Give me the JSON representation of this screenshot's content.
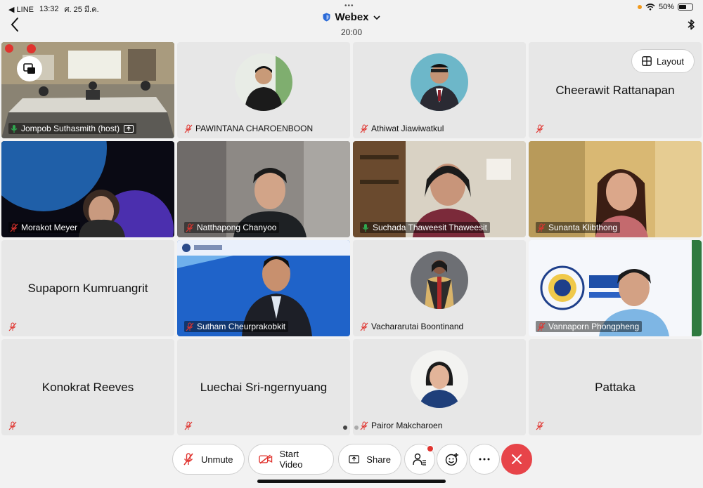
{
  "status_bar": {
    "back_app": "◀ LINE",
    "time": "13:32",
    "date": "ศ. 25 มี.ค.",
    "battery": "50%"
  },
  "header": {
    "app_title": "Webex",
    "meeting_timer": "20:00"
  },
  "layout_button": {
    "label": "Layout"
  },
  "participants": [
    {
      "name": "Jompob Suthasmith (host)",
      "mic": "on",
      "kind": "video"
    },
    {
      "name": "PAWINTANA CHAROENBOON",
      "mic": "muted",
      "kind": "avatar"
    },
    {
      "name": "Athiwat Jiawiwatkul",
      "mic": "muted",
      "kind": "avatar"
    },
    {
      "name": "Cheerawit Rattanapan",
      "mic": "muted",
      "kind": "name-only"
    },
    {
      "name": "Morakot Meyer",
      "mic": "muted",
      "kind": "video"
    },
    {
      "name": "Natthapong Chanyoo",
      "mic": "muted",
      "kind": "video"
    },
    {
      "name": "Suchada Thaweesit Thaweesit",
      "mic": "on",
      "kind": "video"
    },
    {
      "name": "Sunanta Klibthong",
      "mic": "muted",
      "kind": "video"
    },
    {
      "name": "Supaporn Kumruangrit",
      "mic": "muted",
      "kind": "name-only"
    },
    {
      "name": "Sutham Cheurprakobkit",
      "mic": "muted",
      "kind": "video"
    },
    {
      "name": "Vachararutai Boontinand",
      "mic": "muted",
      "kind": "avatar"
    },
    {
      "name": "Vannaporn Phongpheng",
      "mic": "muted",
      "kind": "video"
    },
    {
      "name": "Konokrat Reeves",
      "mic": "muted",
      "kind": "name-only"
    },
    {
      "name": "Luechai Sri-ngernyuang",
      "mic": "muted",
      "kind": "name-only"
    },
    {
      "name": "Pairor Makcharoen",
      "mic": "muted",
      "kind": "avatar"
    },
    {
      "name": "Pattaka",
      "mic": "muted",
      "kind": "name-only"
    }
  ],
  "toolbar": {
    "unmute_label": "Unmute",
    "start_video_label": "Start Video",
    "share_label": "Share"
  },
  "colors": {
    "active_speaker": "#4fc8b6",
    "end_call": "#e74449",
    "muted_icon": "#e0342f",
    "unmuted_icon": "#2fa84f"
  },
  "icons": [
    "back-chevron-icon",
    "shield-icon",
    "chevron-down-icon",
    "bluetooth-icon",
    "layout-grid-icon",
    "mic-muted-icon",
    "mic-icon",
    "share-screen-icon",
    "participants-icon",
    "reactions-icon",
    "more-icon",
    "close-icon"
  ]
}
